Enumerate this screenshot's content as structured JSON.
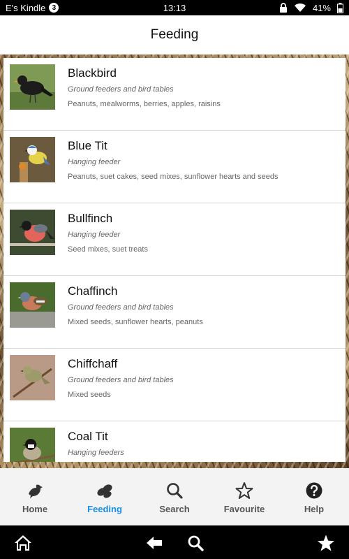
{
  "status": {
    "device": "E's Kindle",
    "badge": "3",
    "time": "13:13",
    "battery": "41%"
  },
  "title": "Feeding",
  "birds": [
    {
      "name": "Blackbird",
      "place": "Ground feeders and bird tables",
      "food": "Peanuts, mealworms, berries, apples, raisins"
    },
    {
      "name": "Blue Tit",
      "place": "Hanging feeder",
      "food": "Peanuts, suet cakes, seed mixes, sunflower hearts and seeds"
    },
    {
      "name": "Bullfinch",
      "place": "Hanging feeder",
      "food": "Seed mixes, suet treats"
    },
    {
      "name": "Chaffinch",
      "place": "Ground feeders and bird tables",
      "food": "Mixed seeds, sunflower hearts, peanuts"
    },
    {
      "name": "Chiffchaff",
      "place": "Ground feeders and bird tables",
      "food": "Mixed seeds"
    },
    {
      "name": "Coal Tit",
      "place": "Hanging feeders",
      "food": ""
    }
  ],
  "tabs": [
    {
      "label": "Home",
      "icon": "bird-icon"
    },
    {
      "label": "Feeding",
      "icon": "seeds-icon",
      "active": true
    },
    {
      "label": "Search",
      "icon": "search-icon"
    },
    {
      "label": "Favourite",
      "icon": "star-outline-icon"
    },
    {
      "label": "Help",
      "icon": "help-icon"
    }
  ],
  "colors": {
    "active_tab": "#1a8fe0",
    "inactive_tab": "#555555"
  }
}
